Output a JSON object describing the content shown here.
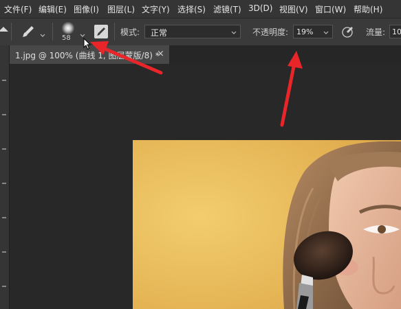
{
  "menu": [
    "文件(F)",
    "编辑(E)",
    "图像(I)",
    "图层(L)",
    "文字(Y)",
    "选择(S)",
    "滤镜(T)",
    "3D(D)",
    "视图(V)",
    "窗口(W)",
    "帮助(H)"
  ],
  "options": {
    "brush_size": "58",
    "mode_label": "模式:",
    "mode_value": "正常",
    "opacity_label": "不透明度:",
    "opacity_value": "19%",
    "flow_label": "流量:",
    "flow_value": "10"
  },
  "tab": {
    "title": "1.jpg @ 100% (曲线 1, 图层蒙版/8) *",
    "close": "×"
  },
  "colors": {
    "annotation_arrow": "#e8262a",
    "canvas_bg": "#e8b95a"
  }
}
